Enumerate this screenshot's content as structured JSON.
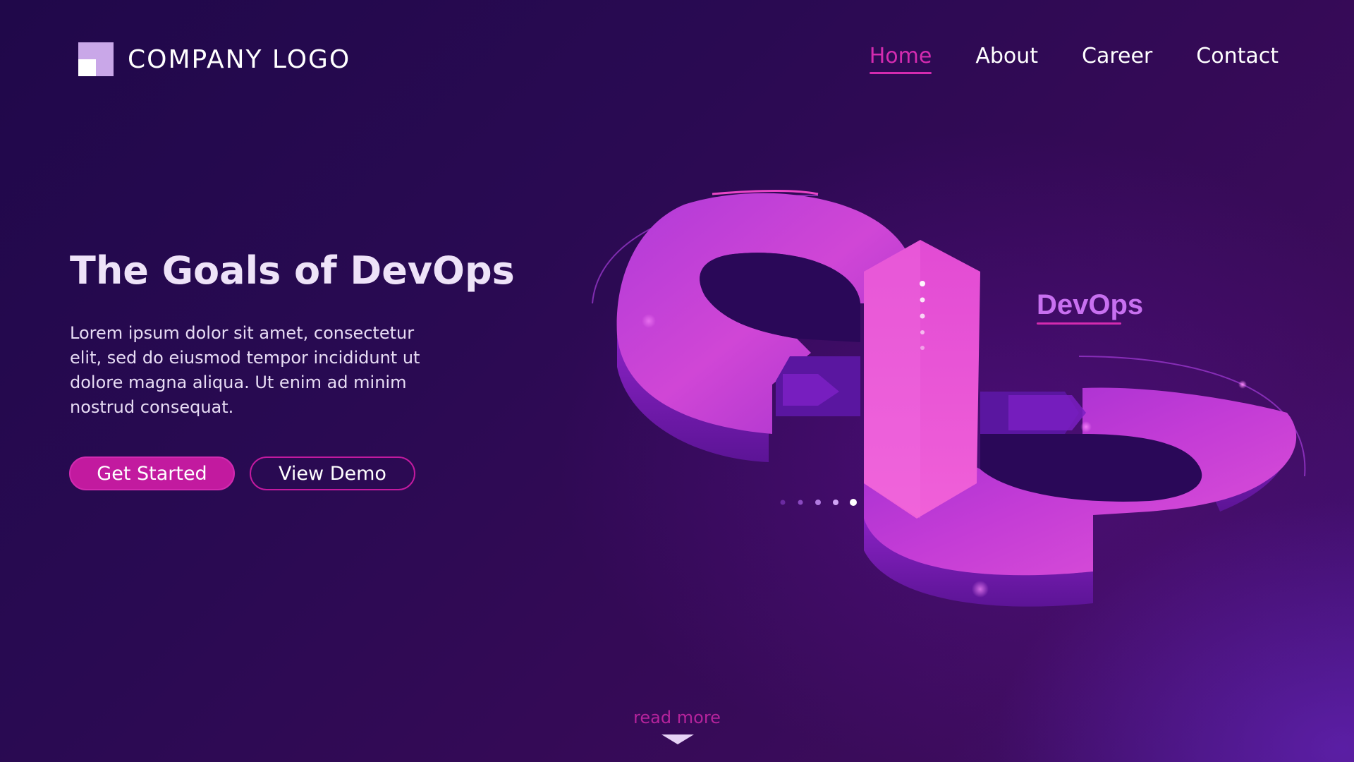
{
  "header": {
    "logo_text": "COMPANY LOGO",
    "nav": [
      {
        "label": "Home",
        "active": true
      },
      {
        "label": "About",
        "active": false
      },
      {
        "label": "Career",
        "active": false
      },
      {
        "label": "Contact",
        "active": false
      }
    ]
  },
  "hero": {
    "title": "The Goals of DevOps",
    "body": "Lorem ipsum dolor sit amet, consectetur elit, sed do eiusmod tempor incididunt ut dolore magna aliqua. Ut enim ad minim nostrud consequat.",
    "primary_button": "Get Started",
    "secondary_button": "View Demo"
  },
  "illustration": {
    "label": "DevOps",
    "icon": "devops-infinity-icon",
    "carousel_dots": 5,
    "active_dot": 5
  },
  "footer": {
    "read_more": "read more",
    "arrow_icon": "chevron-down-icon"
  },
  "colors": {
    "accent": "#c21a9f",
    "nav_active": "#d42bb0",
    "background": "#2a0a52",
    "logo_mark": "#c9a7e8",
    "loop_pink": "#e24bd4",
    "loop_purple": "#9a2fd0"
  }
}
